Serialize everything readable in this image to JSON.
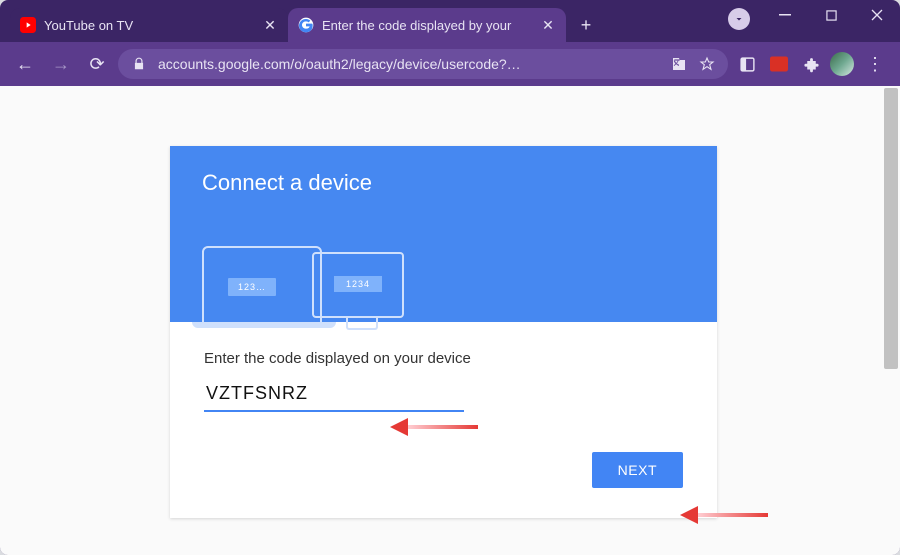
{
  "browser": {
    "tabs": [
      {
        "title": "YouTube on TV",
        "favicon": "youtube"
      },
      {
        "title": "Enter the code displayed by your",
        "favicon": "google"
      }
    ],
    "active_tab_index": 1,
    "url": "accounts.google.com/o/oauth2/legacy/device/usercode?…",
    "window_controls": {
      "minimize": "–",
      "maximize": "▢",
      "close": "✕"
    },
    "newtab_glyph": "+",
    "chevron_glyph": "▾",
    "nav": {
      "back": "←",
      "forward": "→",
      "reload": "⟳"
    },
    "omnibox_icons": {
      "lock": "lock",
      "translate": "translate",
      "star": "star"
    },
    "ext_icons": [
      "panel",
      "red-square",
      "puzzle"
    ],
    "kebab": "⋮"
  },
  "page": {
    "header_title": "Connect a device",
    "illus_laptop_code": "123…",
    "illus_monitor_code": "1234",
    "input_label": "Enter the code displayed on your device",
    "code_value": "VZTFSNRZ",
    "next_button": "NEXT"
  }
}
